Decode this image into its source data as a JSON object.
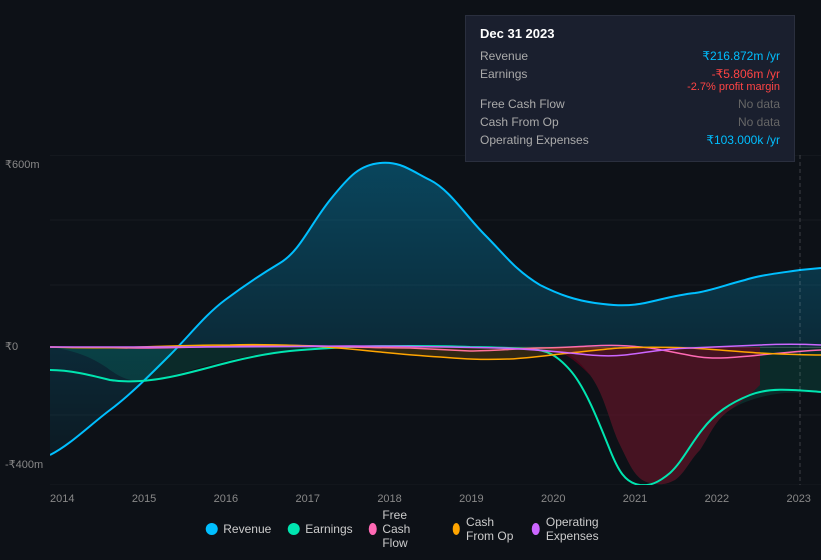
{
  "tooltip": {
    "date": "Dec 31 2023",
    "rows": [
      {
        "label": "Revenue",
        "value": "₹216.872m /yr",
        "class": "blue"
      },
      {
        "label": "Earnings",
        "value": "-₹5.806m /yr",
        "class": "red",
        "sub": "-2.7% profit margin"
      },
      {
        "label": "Free Cash Flow",
        "value": "No data",
        "class": "no-data"
      },
      {
        "label": "Cash From Op",
        "value": "No data",
        "class": "no-data"
      },
      {
        "label": "Operating Expenses",
        "value": "₹103.000k /yr",
        "class": "blue"
      }
    ]
  },
  "yLabels": {
    "top": "₹600m",
    "mid": "₹0",
    "bot": "-₹400m"
  },
  "xLabels": [
    "2014",
    "2015",
    "2016",
    "2017",
    "2018",
    "2019",
    "2020",
    "2021",
    "2022",
    "2023"
  ],
  "legend": [
    {
      "label": "Revenue",
      "dotClass": "dot-blue"
    },
    {
      "label": "Earnings",
      "dotClass": "dot-teal"
    },
    {
      "label": "Free Cash Flow",
      "dotClass": "dot-pink"
    },
    {
      "label": "Cash From Op",
      "dotClass": "dot-orange"
    },
    {
      "label": "Operating Expenses",
      "dotClass": "dot-purple"
    }
  ]
}
